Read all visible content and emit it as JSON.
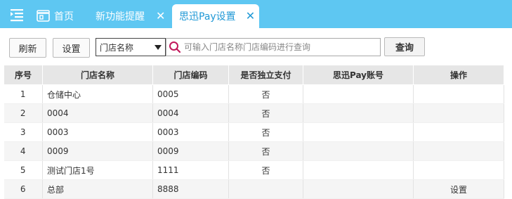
{
  "tabs": {
    "home_label": "首页",
    "reminder_label": "新功能提醒",
    "active_label": "思迅Pay设置",
    "close_glyph": "✕"
  },
  "toolbar": {
    "refresh_label": "刷新",
    "settings_label": "设置",
    "filter_selected": "门店名称",
    "search_placeholder": "可输入门店名称门店编码进行查询",
    "search_value": "",
    "query_label": "查询"
  },
  "table": {
    "headers": [
      "序号",
      "门店名称",
      "门店编码",
      "是否独立支付",
      "思迅Pay账号",
      "操作"
    ],
    "rows": [
      {
        "no": "1",
        "name": "仓储中心",
        "code": "0005",
        "independent": "否",
        "account": "",
        "op": ""
      },
      {
        "no": "2",
        "name": "0004",
        "code": "0004",
        "independent": "否",
        "account": "",
        "op": ""
      },
      {
        "no": "3",
        "name": "0003",
        "code": "0003",
        "independent": "否",
        "account": "",
        "op": ""
      },
      {
        "no": "4",
        "name": "0009",
        "code": "0009",
        "independent": "否",
        "account": "",
        "op": ""
      },
      {
        "no": "5",
        "name": "测试门店1号",
        "code": "1111",
        "independent": "否",
        "account": "",
        "op": ""
      },
      {
        "no": "6",
        "name": "总部",
        "code": "8888",
        "independent": "",
        "account": "",
        "op": "设置"
      }
    ]
  },
  "colors": {
    "tabbar_bg": "#5ec7f2",
    "active_tab_text": "#2199d6",
    "link": "#2b8ccc",
    "search_icon": "#c2185b"
  },
  "icons": [
    "menu-icon",
    "home-icon",
    "close-icon",
    "search-icon",
    "dropdown-caret-icon"
  ]
}
